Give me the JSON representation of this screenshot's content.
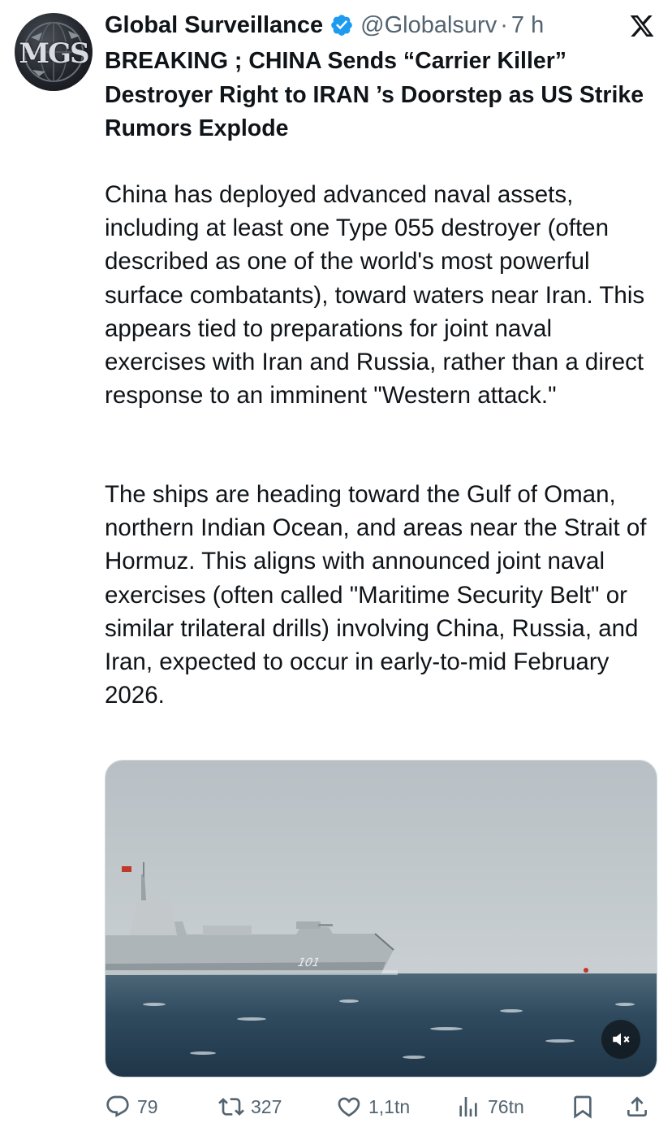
{
  "author": {
    "display_name": "Global Surveillance",
    "handle": "@Globalsurv",
    "separator": "·",
    "time": "7 h",
    "avatar_text": "MGS",
    "verified_icon": "verified-badge-icon"
  },
  "platform_icon": "x-logo-icon",
  "post": {
    "headline": "BREAKING ; CHINA Sends “Carrier Killer” Destroyer Right to IRAN ’s Doorstep as US Strike Rumors Explode",
    "paragraph_1": "China has deployed advanced naval assets, including at least one Type 055 destroyer (often described as one of the world's most powerful surface combatants), toward waters near Iran. This appears tied to preparations for joint naval exercises with Iran and Russia, rather than a direct response to an imminent \"Western attack.\"",
    "paragraph_2": "The ships are heading toward the Gulf of Oman, northern Indian Ocean, and areas near the Strait of Hormuz. This aligns with announced joint naval exercises (often called \"Maritime Security Belt\" or similar trilateral drills) involving China, Russia, and Iran, expected to occur in early-to-mid February 2026."
  },
  "media": {
    "hull_number": "101",
    "mute_icon": "speaker-muted-icon"
  },
  "actions": {
    "replies": "79",
    "reposts": "327",
    "likes": "1,1tn",
    "views": "76tn",
    "bookmark_icon": "bookmark-icon",
    "share_icon": "share-icon"
  },
  "colors": {
    "text": "#0f1419",
    "secondary": "#536471",
    "verified": "#1d9bf0",
    "background": "#ffffff"
  }
}
